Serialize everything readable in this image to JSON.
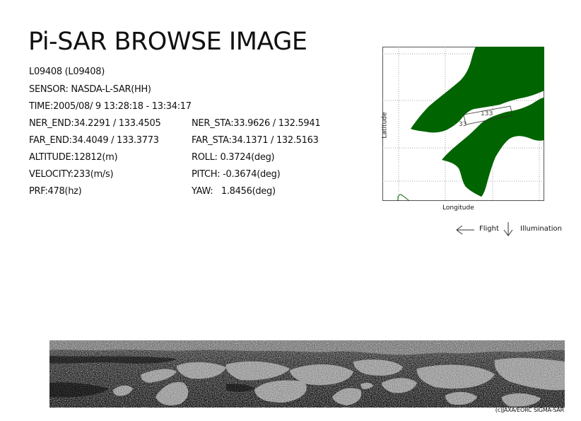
{
  "header": {
    "title": "Pi-SAR BROWSE IMAGE"
  },
  "info": {
    "scene_id": "L09408 (L09408)",
    "sensor": "SENSOR: NASDA-L-SAR(HH)",
    "time": "TIME:2005/08/ 9  13:28:18 - 13:34:17",
    "ner_end": "NER_END:34.2291 / 133.4505",
    "ner_sta": "NER_STA:33.9626 / 132.5941",
    "far_end": "FAR_END:34.4049 / 133.3773",
    "far_sta": "FAR_STA:34.1371 / 132.5163",
    "altitude": "ALTITUDE:12812(m)",
    "roll": "ROLL: 0.3724(deg)",
    "velocity": "VELOCITY:233(m/s)",
    "pitch": "PITCH: -0.3674(deg)",
    "prf": "PRF:478(hz)",
    "yaw": "YAW:   1.8456(deg)"
  },
  "map": {
    "lat_axis_label": "Latitude",
    "lon_axis_label": "Longitude",
    "grid_label_1": "133",
    "grid_label_2": "33",
    "land_color": "#006400",
    "grid_color": "#555555"
  },
  "legend": {
    "flight_label": "Flight",
    "illumination_label": "Illumination",
    "flight_icon": "arrow-left-icon",
    "illumination_icon": "arrow-down-icon"
  },
  "footer": {
    "credit": "(c)JAXA/EORC SIGMA-SAR"
  }
}
